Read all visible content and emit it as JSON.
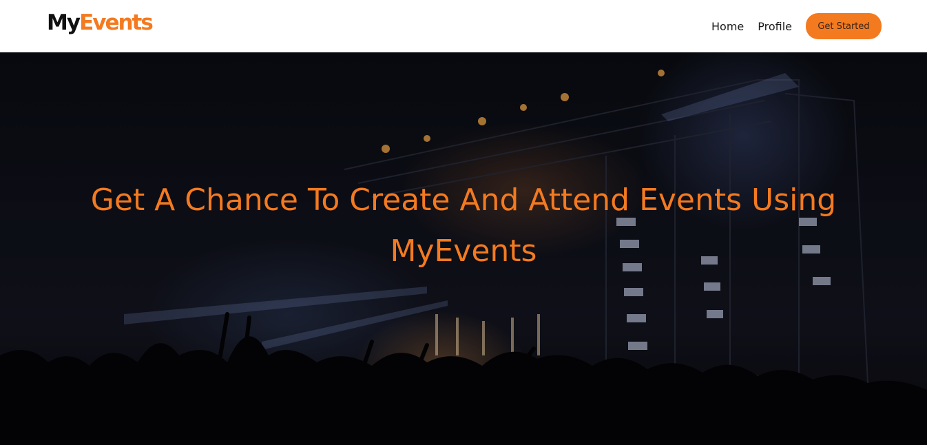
{
  "navbar": {
    "logo": {
      "part1": "My",
      "part2": "Events"
    },
    "links": [
      {
        "label": "Home"
      },
      {
        "label": "Profile"
      }
    ],
    "cta_label": "Get Started"
  },
  "hero": {
    "headline": "Get A Chance To Create And Attend Events Using MyEvents",
    "accent_color": "#f47a20"
  }
}
